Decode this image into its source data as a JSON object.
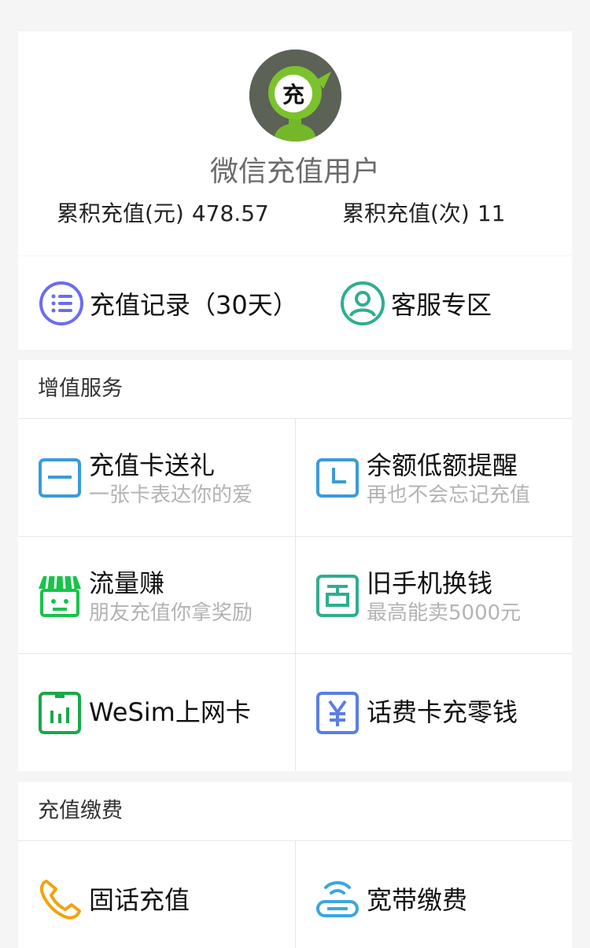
{
  "profile": {
    "avatar_text": "充",
    "nickname": "微信充值用户",
    "total_amount_label": "累积充值(元)",
    "total_amount_value": "478.57",
    "total_count_label": "累积充值(次)",
    "total_count_value": "11"
  },
  "quick_links": {
    "records": {
      "label": "充值记录（30天）",
      "icon": "list-icon",
      "color": "#6b6cf0"
    },
    "service": {
      "label": "客服专区",
      "icon": "person-icon",
      "color": "#2fae8e"
    }
  },
  "value_added": {
    "title": "增值服务",
    "items": [
      {
        "title": "充值卡送礼",
        "subtitle": "一张卡表达你的爱",
        "icon": "gift-card-icon",
        "color": "#3b9bd9"
      },
      {
        "title": "余额低额提醒",
        "subtitle": "再也不会忘记充值",
        "icon": "clock-icon",
        "color": "#3b9bd9"
      },
      {
        "title": "流量赚",
        "subtitle": "朋友充值你拿奖励",
        "icon": "shop-icon",
        "color": "#19c34a"
      },
      {
        "title": "旧手机换钱",
        "subtitle": "最高能卖5000元",
        "icon": "trade-in-icon",
        "color": "#2fae8e"
      },
      {
        "title": "WeSim上网卡",
        "subtitle": "",
        "icon": "sim-card-icon",
        "color": "#19a84a"
      },
      {
        "title": "话费卡充零钱",
        "subtitle": "",
        "icon": "yuan-card-icon",
        "color": "#5b7ee0"
      }
    ]
  },
  "recharge": {
    "title": "充值缴费",
    "items": [
      {
        "title": "固话充值",
        "icon": "phone-icon",
        "color": "#f2a20c"
      },
      {
        "title": "宽带缴费",
        "icon": "broadband-icon",
        "color": "#3aa7e0"
      }
    ]
  }
}
